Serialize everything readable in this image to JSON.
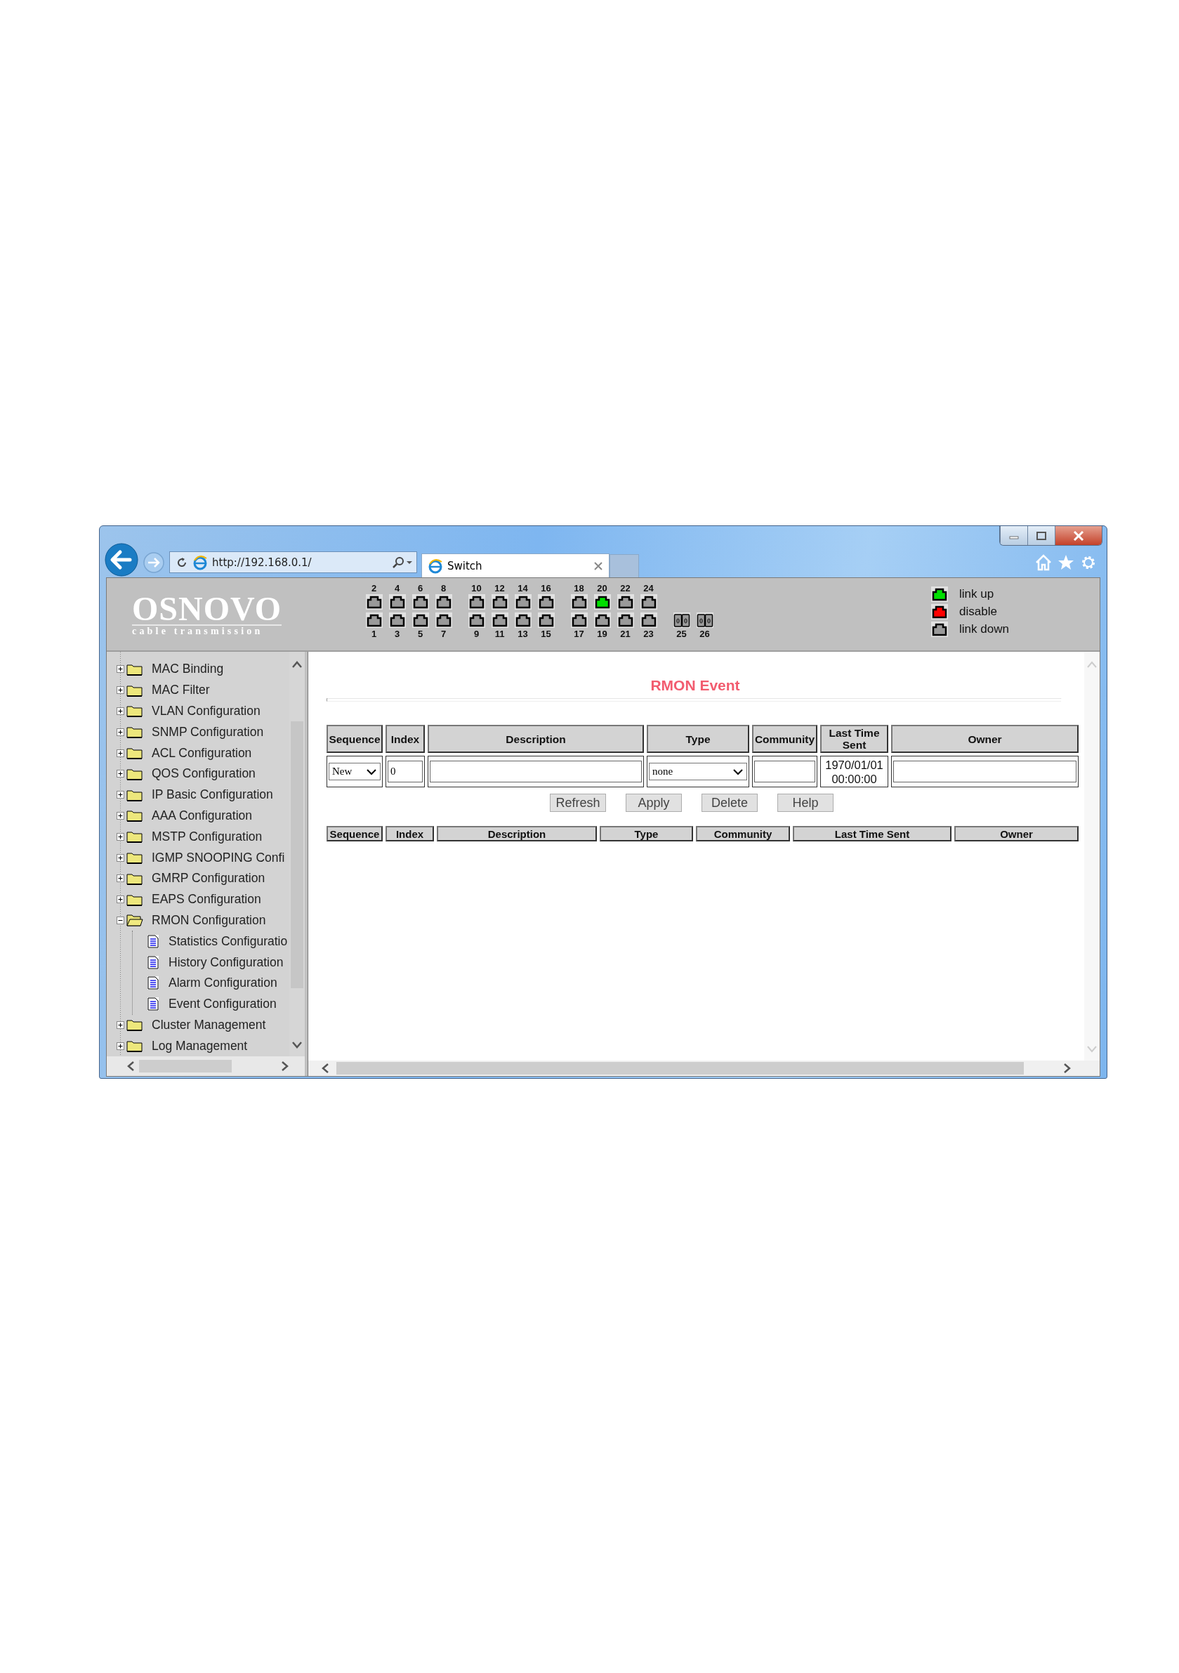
{
  "browser": {
    "address": "http://192.168.0.1/",
    "tab_title": "Switch"
  },
  "header": {
    "logo": {
      "name": "OSNOVO",
      "tagline": "cable transmission"
    },
    "port_groups": [
      [
        {
          "top": {
            "number": "2",
            "color": "#9a9a9a",
            "kind": "copper"
          },
          "bottom": {
            "number": "1",
            "color": "#9a9a9a",
            "kind": "copper"
          }
        },
        {
          "top": {
            "number": "4",
            "color": "#9a9a9a",
            "kind": "copper"
          },
          "bottom": {
            "number": "3",
            "color": "#9a9a9a",
            "kind": "copper"
          }
        },
        {
          "top": {
            "number": "6",
            "color": "#9a9a9a",
            "kind": "copper"
          },
          "bottom": {
            "number": "5",
            "color": "#9a9a9a",
            "kind": "copper"
          }
        },
        {
          "top": {
            "number": "8",
            "color": "#9a9a9a",
            "kind": "copper"
          },
          "bottom": {
            "number": "7",
            "color": "#9a9a9a",
            "kind": "copper"
          }
        }
      ],
      [
        {
          "top": {
            "number": "10",
            "color": "#9a9a9a",
            "kind": "copper"
          },
          "bottom": {
            "number": "9",
            "color": "#9a9a9a",
            "kind": "copper"
          }
        },
        {
          "top": {
            "number": "12",
            "color": "#9a9a9a",
            "kind": "copper"
          },
          "bottom": {
            "number": "11",
            "color": "#9a9a9a",
            "kind": "copper"
          }
        },
        {
          "top": {
            "number": "14",
            "color": "#9a9a9a",
            "kind": "copper"
          },
          "bottom": {
            "number": "13",
            "color": "#9a9a9a",
            "kind": "copper"
          }
        },
        {
          "top": {
            "number": "16",
            "color": "#9a9a9a",
            "kind": "copper"
          },
          "bottom": {
            "number": "15",
            "color": "#9a9a9a",
            "kind": "copper"
          }
        }
      ],
      [
        {
          "top": {
            "number": "18",
            "color": "#9a9a9a",
            "kind": "copper"
          },
          "bottom": {
            "number": "17",
            "color": "#9a9a9a",
            "kind": "copper"
          }
        },
        {
          "top": {
            "number": "20",
            "color": "#00e000",
            "kind": "copper"
          },
          "bottom": {
            "number": "19",
            "color": "#9a9a9a",
            "kind": "copper"
          }
        },
        {
          "top": {
            "number": "22",
            "color": "#9a9a9a",
            "kind": "copper"
          },
          "bottom": {
            "number": "21",
            "color": "#9a9a9a",
            "kind": "copper"
          }
        },
        {
          "top": {
            "number": "24",
            "color": "#9a9a9a",
            "kind": "copper"
          },
          "bottom": {
            "number": "23",
            "color": "#9a9a9a",
            "kind": "copper"
          }
        }
      ],
      [
        {
          "bottom": {
            "number": "25",
            "color": "#9a9a9a",
            "kind": "fiber"
          }
        },
        {
          "bottom": {
            "number": "26",
            "color": "#9a9a9a",
            "kind": "fiber"
          }
        }
      ]
    ],
    "legend": [
      {
        "label": "link up",
        "color": "#00e000"
      },
      {
        "label": "disable",
        "color": "#ff0000"
      },
      {
        "label": "link down",
        "color": "#9a9a9a"
      }
    ]
  },
  "sidebar": {
    "items": [
      {
        "label": "MAC Binding",
        "expanded": false
      },
      {
        "label": "MAC Filter",
        "expanded": false
      },
      {
        "label": "VLAN Configuration",
        "expanded": false
      },
      {
        "label": "SNMP Configuration",
        "expanded": false
      },
      {
        "label": "ACL Configuration",
        "expanded": false
      },
      {
        "label": "QOS Configuration",
        "expanded": false
      },
      {
        "label": "IP Basic Configuration",
        "expanded": false
      },
      {
        "label": "AAA Configuration",
        "expanded": false
      },
      {
        "label": "MSTP Configuration",
        "expanded": false
      },
      {
        "label": "IGMP SNOOPING Confi",
        "expanded": false
      },
      {
        "label": "GMRP Configuration",
        "expanded": false
      },
      {
        "label": "EAPS Configuration",
        "expanded": false
      },
      {
        "label": "RMON Configuration",
        "expanded": true,
        "children": [
          {
            "label": "Statistics Configuratio"
          },
          {
            "label": "History Configuration"
          },
          {
            "label": "Alarm Configuration"
          },
          {
            "label": "Event Configuration"
          }
        ]
      },
      {
        "label": "Cluster Management",
        "expanded": false
      },
      {
        "label": "Log Management",
        "expanded": false
      }
    ]
  },
  "content": {
    "title": "RMON Event",
    "form_table": {
      "columns": [
        "Sequence",
        "Index",
        "Description",
        "Type",
        "Community",
        "Last Time Sent",
        "Owner"
      ],
      "row": [
        {
          "kind": "select",
          "value": "New"
        },
        {
          "kind": "input",
          "value": "0"
        },
        {
          "kind": "input"
        },
        {
          "kind": "select",
          "value": "none"
        },
        {
          "kind": "input"
        },
        {
          "kind": "text",
          "value": "1970/01/01 00:00:00"
        },
        {
          "kind": "input"
        }
      ]
    },
    "buttons": [
      "Refresh",
      "Apply",
      "Delete",
      "Help"
    ],
    "list_table": {
      "columns": [
        "Sequence",
        "Index",
        "Description",
        "Type",
        "Community",
        "Last Time Sent",
        "Owner"
      ]
    }
  }
}
